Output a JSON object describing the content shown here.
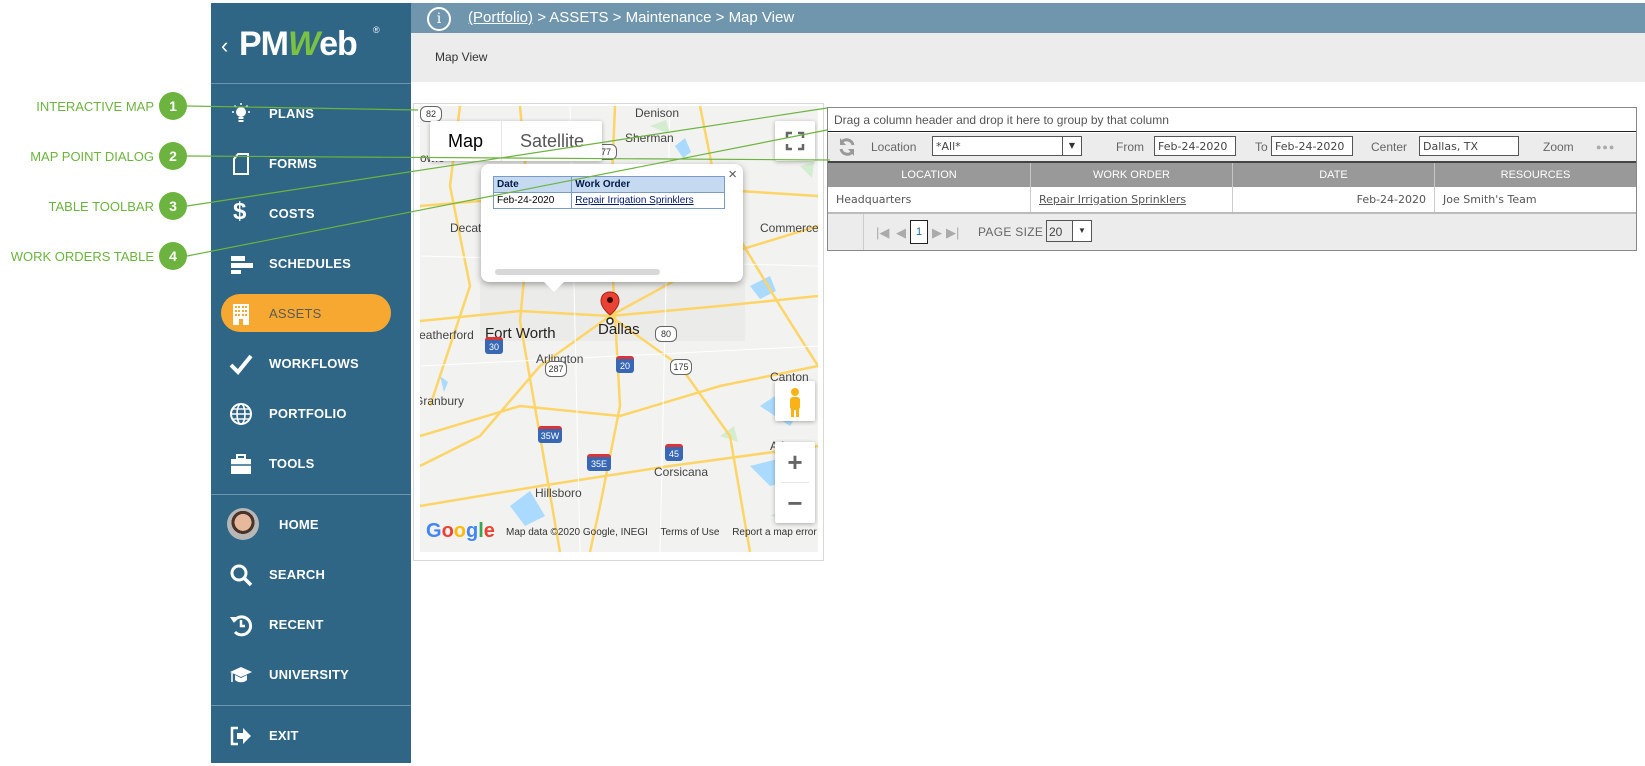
{
  "callouts": [
    {
      "number": "1",
      "label": "INTERACTIVE MAP"
    },
    {
      "number": "2",
      "label": "MAP POINT DIALOG"
    },
    {
      "number": "3",
      "label": "TABLE TOOLBAR"
    },
    {
      "number": "4",
      "label": "WORK ORDERS TABLE"
    }
  ],
  "callout_color": "#6db33f",
  "sidebar": {
    "logo": {
      "back": "‹",
      "text_pm": "PM",
      "text_w": "W",
      "text_eb": "eb",
      "registered": "®"
    },
    "items": [
      {
        "label": "PLANS",
        "icon": "lightbulb-icon"
      },
      {
        "label": "FORMS",
        "icon": "document-icon"
      },
      {
        "label": "COSTS",
        "icon": "dollar-icon"
      },
      {
        "label": "SCHEDULES",
        "icon": "gantt-icon"
      },
      {
        "label": "ASSETS",
        "icon": "building-icon",
        "active": true
      },
      {
        "label": "WORKFLOWS",
        "icon": "checkmark-icon"
      },
      {
        "label": "PORTFOLIO",
        "icon": "globe-icon"
      },
      {
        "label": "TOOLS",
        "icon": "toolbox-icon"
      }
    ],
    "bottom_items": [
      {
        "label": "HOME",
        "icon": "avatar"
      },
      {
        "label": "SEARCH",
        "icon": "search-icon"
      },
      {
        "label": "RECENT",
        "icon": "history-icon"
      },
      {
        "label": "UNIVERSITY",
        "icon": "graduation-cap-icon"
      }
    ],
    "exit_label": "EXIT",
    "colors": {
      "background": "#2f6585",
      "active": "#f7a830"
    }
  },
  "header": {
    "breadcrumb": {
      "link": "(Portfolio)",
      "rest": " > ASSETS > Maintenance > Map View"
    },
    "subtitle": "Map View",
    "colors": {
      "bar": "#7096ad",
      "sub": "#ececec"
    }
  },
  "map": {
    "type_tabs": [
      "Map",
      "Satellite"
    ],
    "active_type": "Map",
    "places": [
      "Denison",
      "Sherman",
      "Bowie",
      "Decatur",
      "Commerce",
      "Weatherford",
      "Fort Worth",
      "Arlington",
      "Dallas",
      "Canton",
      "Granbury",
      "Athens",
      "Hillsboro",
      "Corsicana"
    ],
    "popup": {
      "columns": [
        "Date",
        "Work Order"
      ],
      "rows": [
        {
          "date": "Feb-24-2020",
          "work_order": "Repair Irrigation Sprinklers"
        }
      ],
      "close": "×"
    },
    "footer": {
      "google": "Google",
      "data": "Map data ©2020 Google, INEGI",
      "terms": "Terms of Use",
      "report": "Report a map error"
    },
    "controls": {
      "zoom_in": "+",
      "zoom_out": "−"
    }
  },
  "grid": {
    "group_hint": "Drag a column header and drop it here to group by that column",
    "toolbar": {
      "location_label": "Location",
      "location_value": "*All*",
      "from_label": "From",
      "from_value": "Feb-24-2020",
      "to_label": "To",
      "to_value": "Feb-24-2020",
      "center_label": "Center",
      "center_value": "Dallas, TX",
      "zoom_label": "Zoom",
      "more": "●●●"
    },
    "columns": [
      "LOCATION",
      "WORK ORDER",
      "DATE",
      "RESOURCES"
    ],
    "rows": [
      {
        "location": "Headquarters",
        "work_order": "Repair Irrigation Sprinklers",
        "date": "Feb-24-2020",
        "resources": "Joe Smith's Team"
      }
    ],
    "pager": {
      "current_page": "1",
      "page_size_label": "PAGE SIZE",
      "page_size": "20"
    }
  }
}
